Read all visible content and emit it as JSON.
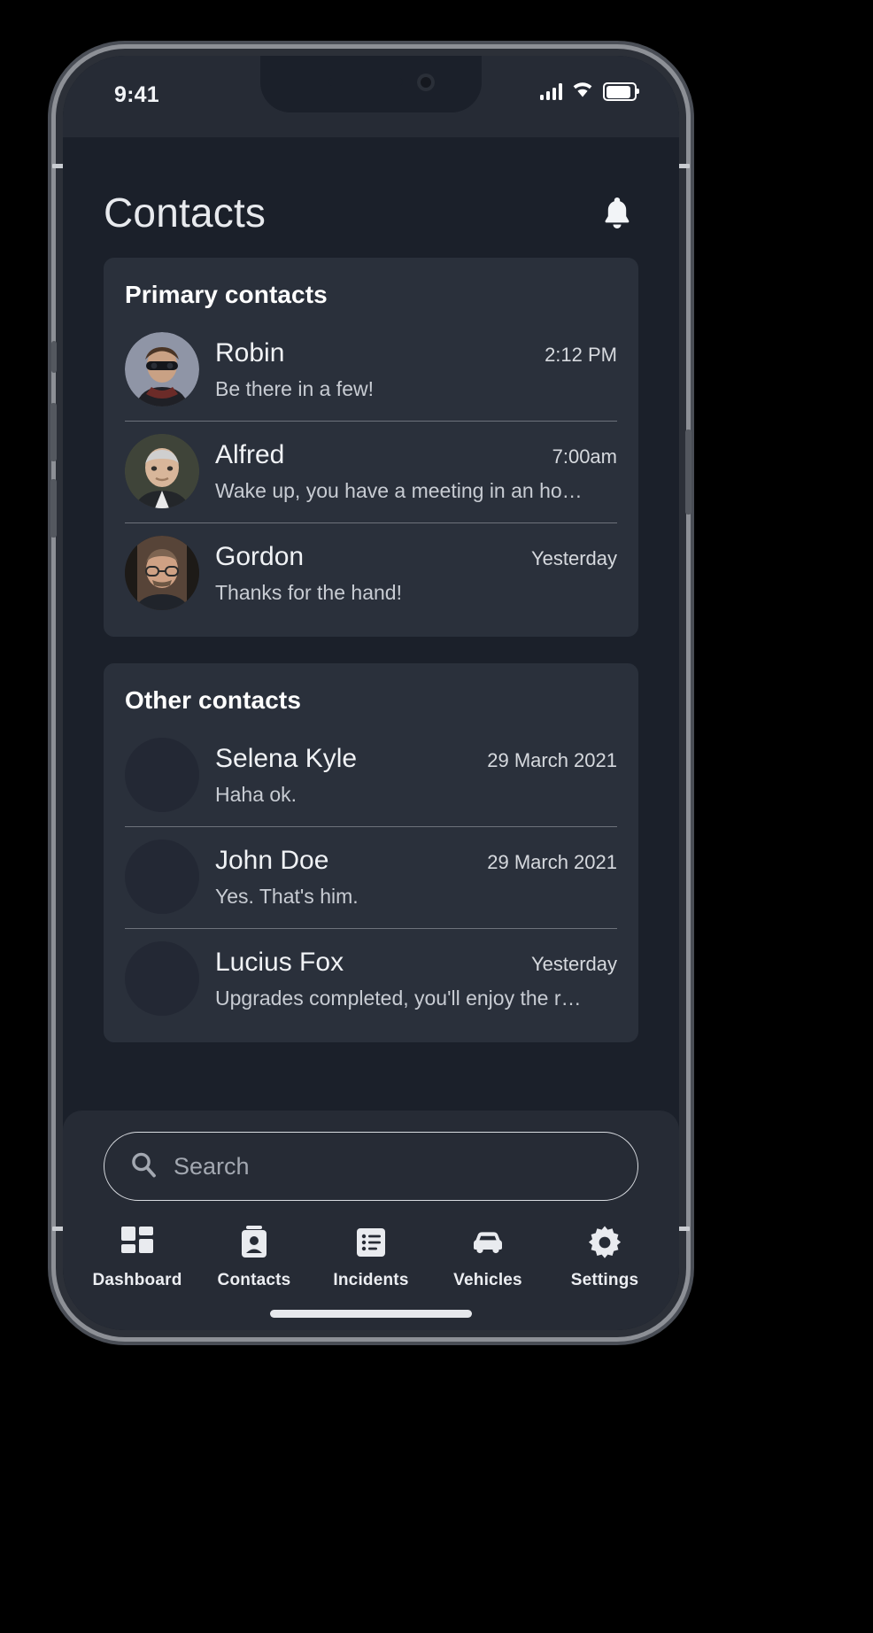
{
  "status_bar": {
    "time": "9:41",
    "signal_icon": "cellular-signal-icon",
    "wifi_icon": "wifi-icon",
    "battery_icon": "battery-full-icon"
  },
  "header": {
    "title": "Contacts",
    "bell_icon": "bell-icon"
  },
  "sections": [
    {
      "title": "Primary contacts",
      "contacts": [
        {
          "name": "Robin",
          "time": "2:12 PM",
          "message": "Be there in a few!",
          "avatar": "photo"
        },
        {
          "name": "Alfred",
          "time": "7:00am",
          "message": "Wake up, you have a meeting in an ho…",
          "avatar": "photo"
        },
        {
          "name": "Gordon",
          "time": "Yesterday",
          "message": "Thanks for the hand!",
          "avatar": "photo"
        }
      ]
    },
    {
      "title": "Other contacts",
      "contacts": [
        {
          "name": "Selena Kyle",
          "time": "29 March 2021",
          "message": "Haha ok.",
          "avatar": "placeholder"
        },
        {
          "name": "John Doe",
          "time": "29 March 2021",
          "message": "Yes. That's him.",
          "avatar": "placeholder"
        },
        {
          "name": "Lucius Fox",
          "time": "Yesterday",
          "message": "Upgrades completed, you'll enjoy the r…",
          "avatar": "placeholder"
        }
      ]
    }
  ],
  "search": {
    "placeholder": "Search",
    "value": "",
    "icon": "search-icon"
  },
  "tabbar": {
    "items": [
      {
        "label": "Dashboard",
        "icon": "grid-dashboard-icon"
      },
      {
        "label": "Contacts",
        "icon": "contact-card-icon"
      },
      {
        "label": "Incidents",
        "icon": "list-icon"
      },
      {
        "label": "Vehicles",
        "icon": "car-icon"
      },
      {
        "label": "Settings",
        "icon": "gear-icon"
      }
    ]
  },
  "colors": {
    "screen_bg": "#1b202a",
    "card_bg": "#2a303b",
    "bar_bg": "#262b35",
    "text_primary": "#f0f2f5",
    "text_secondary": "#c8ccd3"
  }
}
